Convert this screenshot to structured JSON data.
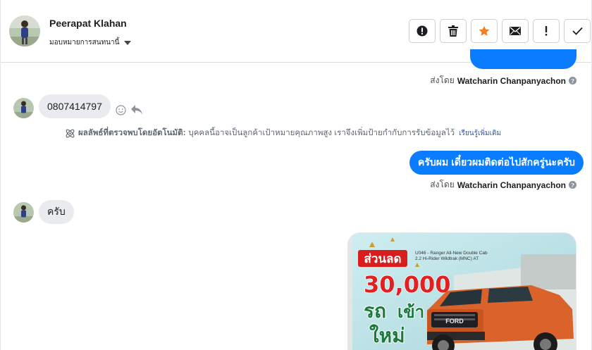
{
  "header": {
    "name": "Peerapat Klahan",
    "assign_label": "มอบหมายการสนทนานี้"
  },
  "toolbar": {
    "buttons": [
      {
        "icon": "exclamation-circle-icon"
      },
      {
        "icon": "trash-icon"
      },
      {
        "icon": "star-icon",
        "color": "#f57c1f"
      },
      {
        "icon": "envelope-icon"
      },
      {
        "icon": "exclamation-icon"
      },
      {
        "icon": "check-icon"
      }
    ]
  },
  "messages": {
    "sent_by_label": "ส่งโดย",
    "sender": "Watcharin Chanpanyachon",
    "incoming_phone": "0807414797",
    "auto_note_title": "ผลลัพธ์ที่ตรวจพบโดยอัตโนมัติ:",
    "auto_note_text": "บุคคลนี้อาจเป็นลูกค้าเป้าหมายคุณภาพสูง เราจึงเพิ่มป้ายกำกับการรับข้อมูลไว้",
    "learn_more": "เรียนรู้เพิ่มเติม",
    "outgoing_reply": "ครับผม เดี๋ยวผมติดต่อไปสักครู่นะครับ",
    "incoming_reply": "ครับ"
  },
  "attachment": {
    "banner": "ส่วนลด",
    "amount": "30,000",
    "model_line1": "U046 - Ranger All-New Double Cab",
    "model_line2": "2.2 Hi-Rider Wildtrak (MNC) AT",
    "slogan_1": "รถ",
    "slogan_2": "เข้า",
    "slogan_3": "ใหม่",
    "grille_text": "FORD"
  },
  "colors": {
    "accent_blue": "#0a7cff",
    "incoming_bubble": "#e9ebee",
    "star": "#f57c1f"
  }
}
